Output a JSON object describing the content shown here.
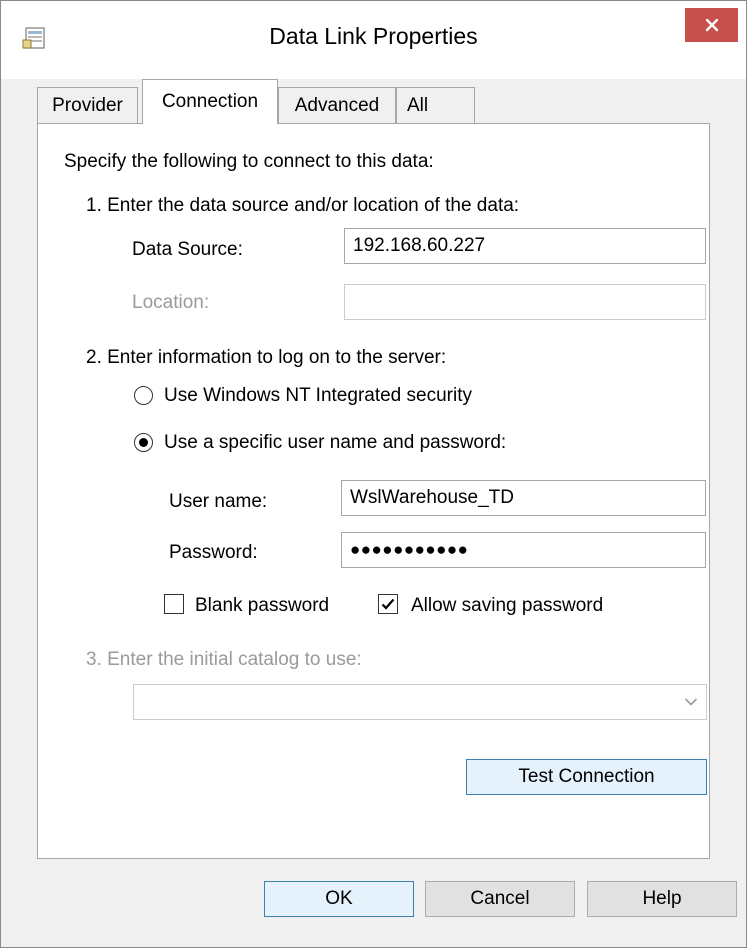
{
  "window": {
    "title": "Data Link Properties",
    "close_label": "✕"
  },
  "tabs": [
    {
      "label": "Provider",
      "active": false
    },
    {
      "label": "Connection",
      "active": true
    },
    {
      "label": "Advanced",
      "active": false
    },
    {
      "label": "All",
      "active": false
    }
  ],
  "connection": {
    "intro": "Specify the following to connect to this data:",
    "step1": "1. Enter the data source and/or location of the data:",
    "data_source_label": "Data Source:",
    "data_source_value": "192.168.60.227",
    "location_label": "Location:",
    "location_value": "",
    "step2": "2. Enter information to log on to the server:",
    "radio_nt_label": "Use Windows NT Integrated security",
    "radio_specific_label": "Use a specific user name and password:",
    "selected_logon": "specific",
    "user_name_label": "User name:",
    "user_name_value": "WslWarehouse_TD",
    "password_label": "Password:",
    "password_value": "●●●●●●●●●●●",
    "blank_password_label": "Blank password",
    "blank_password_checked": false,
    "allow_saving_label": "Allow saving password",
    "allow_saving_checked": true,
    "step3": "3. Enter the initial catalog to use:",
    "catalog_value": "",
    "test_connection_label": "Test Connection"
  },
  "footer": {
    "ok_label": "OK",
    "cancel_label": "Cancel",
    "help_label": "Help"
  },
  "colors": {
    "close_bg": "#c7504c",
    "default_btn_border": "#3c7fb1",
    "disabled_text": "#9a9a9a"
  },
  "icons": {
    "app": "data-link-icon",
    "close": "close-icon",
    "dropdown": "chevron-down-icon",
    "check": "checkmark-icon"
  }
}
